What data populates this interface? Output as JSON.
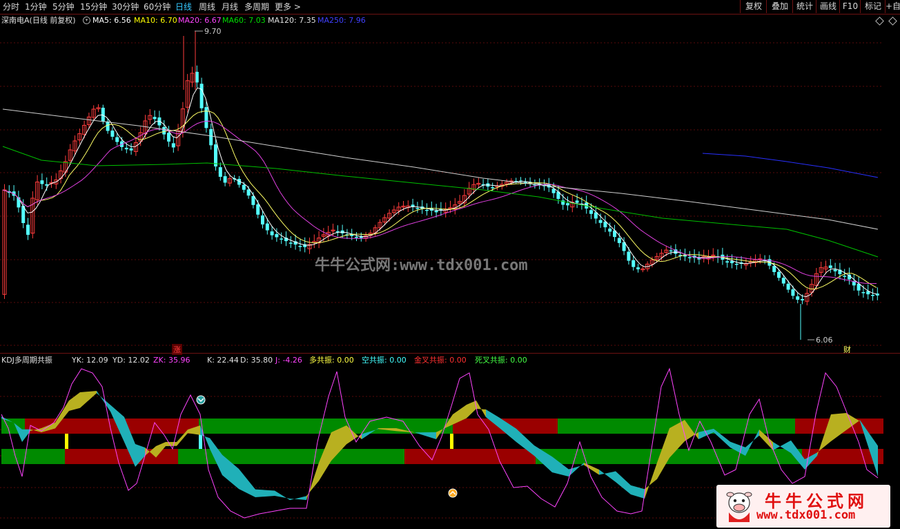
{
  "toolbar": {
    "periods": [
      "分时",
      "1分钟",
      "5分钟",
      "15分钟",
      "30分钟",
      "60分钟",
      "日线",
      "周线",
      "月线",
      "多周期",
      "更多 >"
    ],
    "active_period": "日线",
    "right_buttons": [
      "复权",
      "叠加",
      "统计",
      "画线",
      "F10",
      "标记",
      "+自"
    ]
  },
  "main_chart": {
    "title": "深南电A(日线 前复权)",
    "ma": [
      {
        "label": "MA5: 6.56",
        "color": "#ffffff"
      },
      {
        "label": "MA10: 6.70",
        "color": "#ffff00"
      },
      {
        "label": "MA20: 6.67",
        "color": "#ff44ff"
      },
      {
        "label": "MA60: 7.03",
        "color": "#00e000"
      },
      {
        "label": "MA120: 7.35",
        "color": "#ffffff"
      },
      {
        "label": "MA250: 7.96",
        "color": "#3030ff"
      }
    ],
    "high_label": "9.70",
    "low_label": "6.06",
    "marker_zhang": "涨",
    "marker_cai": "财",
    "watermark": "牛牛公式网:www.tdx001.com",
    "colors": {
      "up": "#ff3c3c",
      "down": "#54ffff",
      "ma5": "#ffffff",
      "ma10": "#ffff66",
      "ma20": "#e040e0",
      "ma60": "#00c000",
      "ma120": "#d0d0d0",
      "ma250": "#2830ff"
    }
  },
  "kdj_panel": {
    "title": "KDJ多周期共振",
    "items": [
      {
        "label": "YK: 12.09",
        "color": "#cccccc"
      },
      {
        "label": "YD: 12.02",
        "color": "#cccccc"
      },
      {
        "label": "ZK: 35.96",
        "color": "#ff44ff"
      },
      {
        "label": "K: 22.44",
        "color": "#cccccc"
      },
      {
        "label": "D: 35.80",
        "color": "#cccccc"
      },
      {
        "label": "J: -4.26",
        "color": "#ff44ff"
      },
      {
        "label": "多共振: 0.00",
        "color": "#ffff44"
      },
      {
        "label": "空共振: 0.00",
        "color": "#44ffff"
      },
      {
        "label": "金叉共振: 0.00",
        "color": "#ff3030"
      },
      {
        "label": "死叉共振: 0.00",
        "color": "#44ff44"
      }
    ],
    "colors": {
      "bull_band": "#b8b020",
      "bear_band": "#20b0b8",
      "red_bar": "#9a0000",
      "green_bar": "#008a00",
      "j_line": "#ff44ff"
    }
  },
  "logo": {
    "line1": "牛牛公式网",
    "line2": "www.tdx001.com"
  }
}
